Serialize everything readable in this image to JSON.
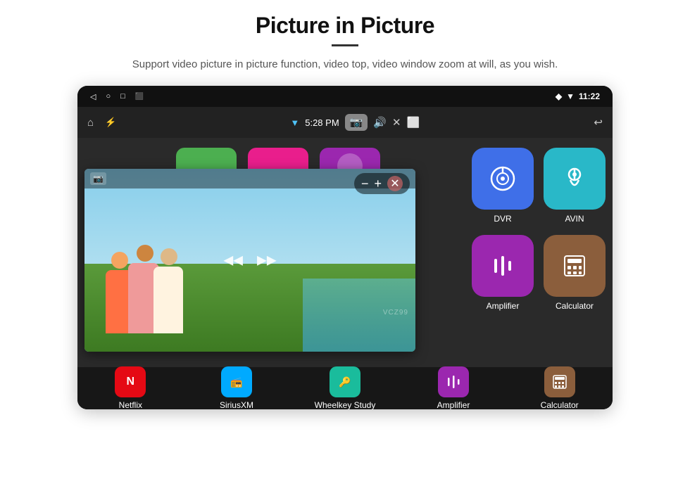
{
  "header": {
    "title": "Picture in Picture",
    "subtitle": "Support video picture in picture function, video top, video window zoom at will, as you wish."
  },
  "status_bar": {
    "time": "11:22",
    "wifi_signal": "▼▲",
    "location_icon": "📍"
  },
  "nav_bar": {
    "time": "5:28 PM",
    "home_icon": "⌂",
    "usb_icon": "⚡",
    "back_icon": "↩"
  },
  "pip_controls": {
    "minus": "−",
    "plus": "+",
    "close": "✕",
    "rewind": "◀◀",
    "play": "▶",
    "forward": "▶▶"
  },
  "apps": {
    "top_row": [
      {
        "id": "dvr",
        "label": "DVR",
        "color": "#3f6fe8",
        "icon": "📡"
      },
      {
        "id": "avin",
        "label": "AVIN",
        "color": "#29b8c8",
        "icon": "🔌"
      }
    ],
    "bottom_row": [
      {
        "id": "amplifier",
        "label": "Amplifier",
        "color": "#9b27af",
        "icon": "🎚"
      },
      {
        "id": "calculator",
        "label": "Calculator",
        "color": "#8b5e3c",
        "icon": "🖩"
      }
    ]
  },
  "bottom_apps": [
    {
      "id": "netflix",
      "label": "Netflix",
      "color": "#e50914"
    },
    {
      "id": "siriusxm",
      "label": "SiriusXM",
      "color": "#00aaff"
    },
    {
      "id": "wheelkey",
      "label": "Wheelkey Study",
      "color": "#1abc9c"
    },
    {
      "id": "amplifier",
      "label": "Amplifier",
      "color": "#9b27af"
    },
    {
      "id": "calculator",
      "label": "Calculator",
      "color": "#8b5e3c"
    }
  ],
  "watermark": "VCZ99"
}
